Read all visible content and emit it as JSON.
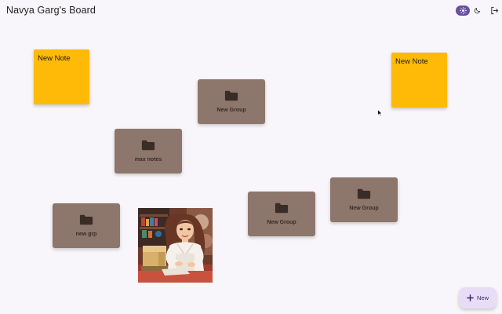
{
  "header": {
    "title": "Navya Garg's Board"
  },
  "notes": [
    {
      "title": "New Note"
    },
    {
      "title": "New Note"
    }
  ],
  "groups": [
    {
      "label": "New Group"
    },
    {
      "label": "max notes"
    },
    {
      "label": "new grp"
    },
    {
      "label": "New Group"
    },
    {
      "label": "New Group"
    }
  ],
  "new_button": {
    "label": "New"
  },
  "colors": {
    "background": "#f8f6fa",
    "note": "#ffba08",
    "group": "#8d766c",
    "accent": "#6750a4",
    "fab": "#e7ddf7"
  }
}
